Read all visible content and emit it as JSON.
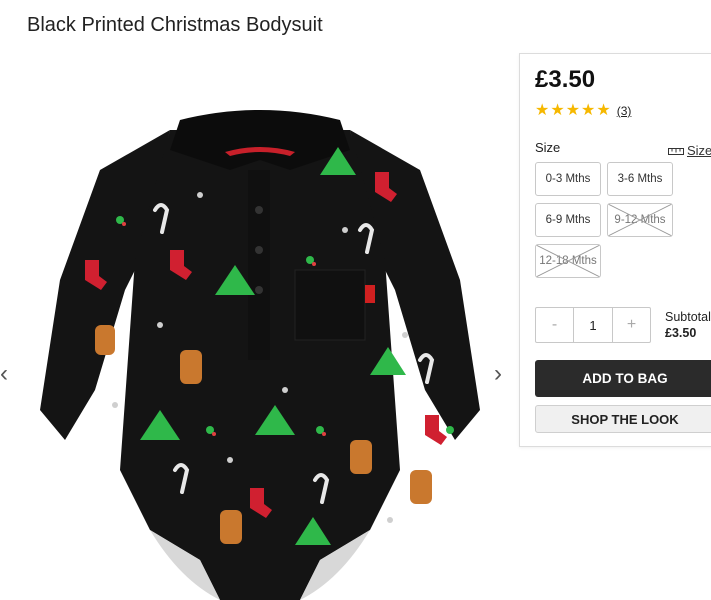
{
  "product": {
    "title": "Black Printed Christmas Bodysuit",
    "price": "£3.50",
    "rating": 5,
    "review_count": "(3)"
  },
  "size": {
    "label": "Size",
    "guide_label": "Size",
    "options": [
      {
        "label": "0-3 Mths",
        "available": true
      },
      {
        "label": "3-6 Mths",
        "available": true
      },
      {
        "label": "6-9 Mths",
        "available": true
      },
      {
        "label": "9-12 Mths",
        "available": false
      },
      {
        "label": "12-18 Mths",
        "available": false
      }
    ]
  },
  "quantity": {
    "minus": "-",
    "value": "1",
    "plus": "+"
  },
  "subtotal": {
    "label": "Subtotal",
    "amount": "£3.50"
  },
  "actions": {
    "add_to_bag": "ADD TO BAG",
    "shop_the_look": "SHOP THE LOOK"
  },
  "gallery": {
    "prev": "‹",
    "next": "›"
  },
  "colors": {
    "star": "#f6b800",
    "primary_button": "#2b2b2b",
    "garment": "#141414"
  }
}
